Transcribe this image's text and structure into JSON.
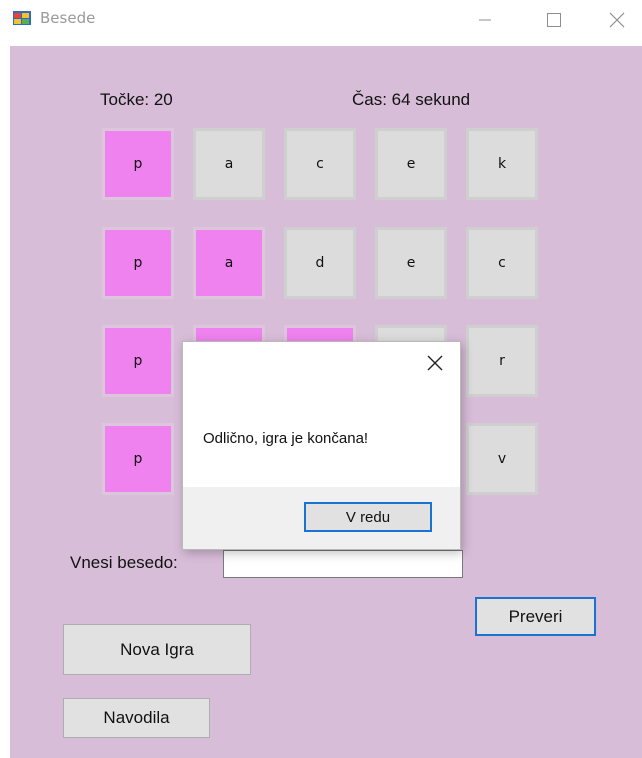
{
  "window": {
    "title": "Besede"
  },
  "score": {
    "text": "Točke: 20"
  },
  "time": {
    "text": "Čas: 64 sekund"
  },
  "grid": {
    "rows": [
      [
        {
          "letter": "p",
          "selected": true
        },
        {
          "letter": "a",
          "selected": false
        },
        {
          "letter": "c",
          "selected": false
        },
        {
          "letter": "e",
          "selected": false
        },
        {
          "letter": "k",
          "selected": false
        }
      ],
      [
        {
          "letter": "p",
          "selected": true
        },
        {
          "letter": "a",
          "selected": true
        },
        {
          "letter": "d",
          "selected": false
        },
        {
          "letter": "e",
          "selected": false
        },
        {
          "letter": "c",
          "selected": false
        }
      ],
      [
        {
          "letter": "p",
          "selected": true
        },
        {
          "letter": "",
          "selected": true
        },
        {
          "letter": "",
          "selected": true
        },
        {
          "letter": "",
          "selected": false
        },
        {
          "letter": "r",
          "selected": false
        }
      ],
      [
        {
          "letter": "p",
          "selected": true
        },
        {
          "letter": "",
          "selected": false
        },
        {
          "letter": "",
          "selected": false
        },
        {
          "letter": "",
          "selected": false
        },
        {
          "letter": "v",
          "selected": false
        }
      ]
    ]
  },
  "word_input": {
    "label": "Vnesi besedo:",
    "value": ""
  },
  "buttons": {
    "check": "Preveri",
    "new_game": "Nova Igra",
    "instructions": "Navodila"
  },
  "dialog": {
    "message": "Odlično, igra je končana!",
    "ok_label": "V redu"
  },
  "colors": {
    "background": "#d8bdd8",
    "selected_tile": "#ef82ef",
    "tile": "#dcdcdc",
    "focus": "#1a73d1"
  }
}
